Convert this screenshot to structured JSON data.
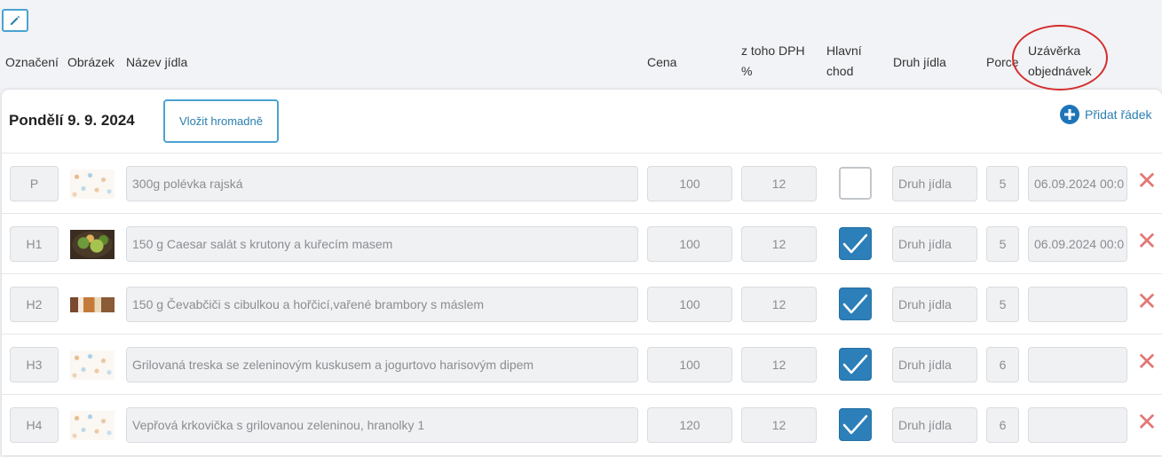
{
  "toolbar": {
    "edit_icon": "pencil-icon"
  },
  "headers": {
    "code": "Označení",
    "image": "Obrázek",
    "name": "Název jídla",
    "price": "Cena",
    "vat": "z toho DPH\n%",
    "main_course": "Hlavní\nchod",
    "type": "Druh jídla",
    "portions": "Porce",
    "deadline": "Uzávěrka\nobjednávek"
  },
  "day": {
    "title": "Pondělí 9. 9. 2024",
    "bulk_insert_label": "Vložit hromadně",
    "add_row_label": "Přidat řádek"
  },
  "colors": {
    "accent": "#2c7fb8",
    "delete": "#e27777",
    "annotation": "#d42d2d"
  },
  "rows": [
    {
      "code": "P",
      "image": "placeholder-pattern",
      "name": "300g polévka rajská",
      "price": "100",
      "vat": "12",
      "main_course": false,
      "type_placeholder": "Druh jídla",
      "portions": "5",
      "deadline": "06.09.2024 00:0"
    },
    {
      "code": "H1",
      "image": "caesar-salad-photo",
      "name": "150 g Caesar salát s krutony a kuřecím masem",
      "price": "100",
      "vat": "12",
      "main_course": true,
      "type_placeholder": "Druh jídla",
      "portions": "5",
      "deadline": "06.09.2024 00:0"
    },
    {
      "code": "H2",
      "image": "cevapcici-photo",
      "name": "150 g Čevabčiči s cibulkou a hořčicí,vařené brambory s máslem",
      "price": "100",
      "vat": "12",
      "main_course": true,
      "type_placeholder": "Druh jídla",
      "portions": "5",
      "deadline": ""
    },
    {
      "code": "H3",
      "image": "placeholder-pattern",
      "name": "Grilovaná treska se zeleninovým kuskusem a jogurtovo harisovým dipem",
      "price": "100",
      "vat": "12",
      "main_course": true,
      "type_placeholder": "Druh jídla",
      "portions": "6",
      "deadline": ""
    },
    {
      "code": "H4",
      "image": "placeholder-pattern",
      "name": "Vepřová krkovička s grilovanou zeleninou, hranolky 1",
      "price": "120",
      "vat": "12",
      "main_course": true,
      "type_placeholder": "Druh jídla",
      "portions": "6",
      "deadline": ""
    }
  ]
}
